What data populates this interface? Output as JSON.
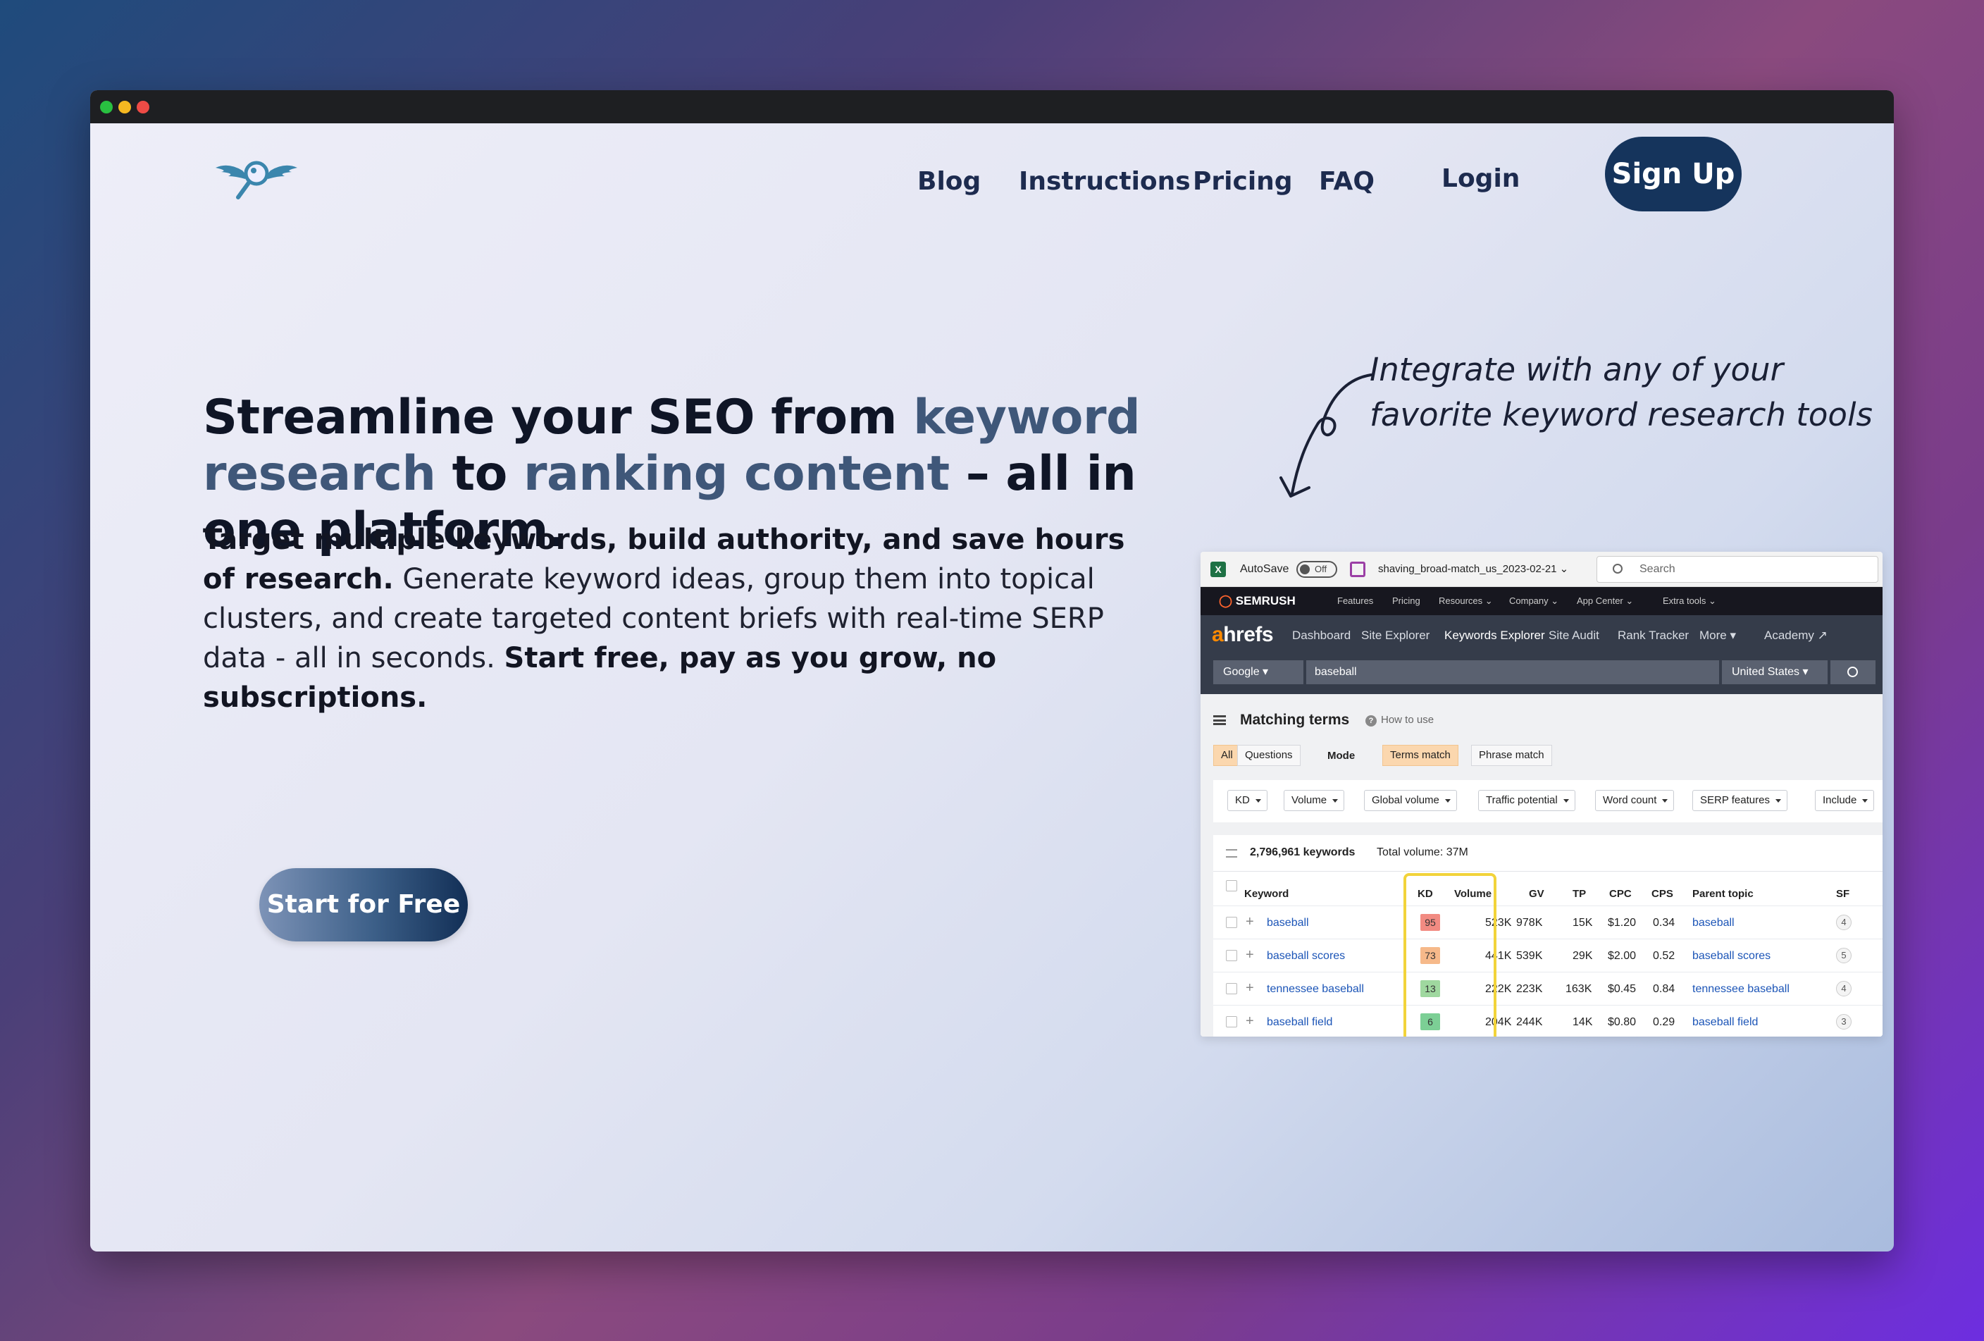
{
  "nav": {
    "logo_name": "owl-magnifier-logo",
    "links": [
      "Blog",
      "Instructions",
      "Pricing",
      "FAQ",
      "Login"
    ],
    "signup": "Sign Up"
  },
  "hero": {
    "headline": [
      {
        "text": "Streamline your SEO from ",
        "hl": false
      },
      {
        "text": "keyword research",
        "hl": true
      },
      {
        "text": " to ",
        "hl": false
      },
      {
        "text": "ranking content",
        "hl": true
      },
      {
        "text": " – all in one platform.",
        "hl": false
      }
    ],
    "sub_bold_1": "Target multiple keywords, build authority, and save hours of research.",
    "sub_text": " Generate keyword ideas, group them into topical clusters, and create targeted content briefs with real-time SERP data - all in seconds. ",
    "sub_bold_2": "Start free, pay as you grow, no subscriptions.",
    "cta": "Start for Free"
  },
  "callout": {
    "line1": "Integrate with any of your",
    "line2": "favorite keyword research tools"
  },
  "screenshot": {
    "excel": {
      "autosave": "AutoSave",
      "toggle": "Off",
      "filename": "shaving_broad-match_us_2023-02-21 ⌄",
      "search_placeholder": "Search"
    },
    "semrush": {
      "brand": "SEMRUSH",
      "nav": [
        "Features",
        "Pricing",
        "Resources ⌄",
        "Company ⌄",
        "App Center ⌄",
        "Extra tools ⌄"
      ]
    },
    "ahrefs": {
      "logo_a": "a",
      "logo_rest": "hrefs",
      "nav": [
        "Dashboard",
        "Site Explorer",
        "Keywords Explorer",
        "Site Audit",
        "Rank Tracker",
        "More ▾",
        "Academy ↗"
      ],
      "active_nav": "Keywords Explorer",
      "engine": "Google ▾",
      "query": "baseball",
      "country": "United States ▾"
    },
    "matching": {
      "title": "Matching terms",
      "how_to": "How to use",
      "tabs": [
        "All",
        "Questions"
      ],
      "mode_label": "Mode",
      "modes": [
        "Terms match",
        "Phrase match"
      ],
      "filters": [
        "KD",
        "Volume",
        "Global volume",
        "Traffic potential",
        "Word count",
        "SERP features",
        "Include"
      ],
      "count": "2,796,961 keywords",
      "total_volume": "Total volume: 37M",
      "columns": [
        "Keyword",
        "KD",
        "Volume",
        "GV",
        "TP",
        "CPC",
        "CPS",
        "Parent topic",
        "SF"
      ],
      "rows": [
        {
          "keyword": "baseball",
          "kd": "95",
          "kd_color": "#f28b82",
          "volume": "523K",
          "gv": "978K",
          "tp": "15K",
          "cpc": "$1.20",
          "cps": "0.34",
          "parent": "baseball",
          "sf": "4"
        },
        {
          "keyword": "baseball scores",
          "kd": "73",
          "kd_color": "#f6b98a",
          "volume": "441K",
          "gv": "539K",
          "tp": "29K",
          "cpc": "$2.00",
          "cps": "0.52",
          "parent": "baseball scores",
          "sf": "5"
        },
        {
          "keyword": "tennessee baseball",
          "kd": "13",
          "kd_color": "#9fd89f",
          "volume": "222K",
          "gv": "223K",
          "tp": "163K",
          "cpc": "$0.45",
          "cps": "0.84",
          "parent": "tennessee baseball",
          "sf": "4"
        },
        {
          "keyword": "baseball field",
          "kd": "6",
          "kd_color": "#7ccf95",
          "volume": "204K",
          "gv": "244K",
          "tp": "14K",
          "cpc": "$0.80",
          "cps": "0.29",
          "parent": "baseball field",
          "sf": "3"
        }
      ]
    }
  },
  "colors": {
    "brand_dark": "#15345c",
    "headline_highlight": "#3f5779",
    "link_blue": "#1c55b7",
    "highlight_yellow": "#f2d33a"
  }
}
